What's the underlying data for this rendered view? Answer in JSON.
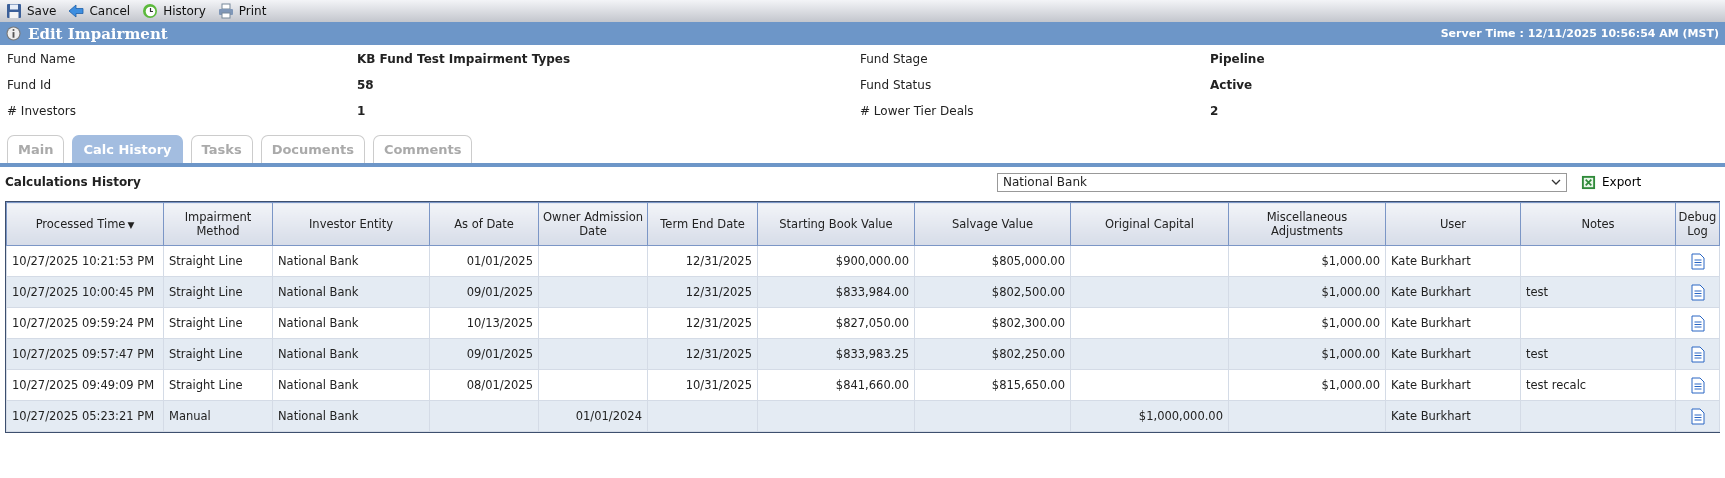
{
  "toolbar": [
    {
      "label": "Save"
    },
    {
      "label": "Cancel"
    },
    {
      "label": "History"
    },
    {
      "label": "Print"
    }
  ],
  "header": {
    "title": "Edit Impairment",
    "server_time": "Server Time : 12/11/2025 10:56:54 AM (MST)"
  },
  "fund_info": [
    {
      "label": "Fund Name",
      "value": "KB Fund Test Impairment Types"
    },
    {
      "label": "Fund Stage",
      "value": "Pipeline"
    },
    {
      "label": "Fund Id",
      "value": "58"
    },
    {
      "label": "Fund Status",
      "value": "Active"
    },
    {
      "label": "# Investors",
      "value": "1"
    },
    {
      "label": "# Lower Tier Deals",
      "value": "2"
    }
  ],
  "tabs": [
    {
      "label": "Main",
      "selected": false
    },
    {
      "label": "Calc History",
      "selected": true
    },
    {
      "label": "Tasks",
      "selected": false
    },
    {
      "label": "Documents",
      "selected": false
    },
    {
      "label": "Comments",
      "selected": false
    }
  ],
  "section": {
    "title": "Calculations History",
    "filter_value": "National Bank",
    "export_label": "Export"
  },
  "table": {
    "columns": [
      {
        "label": "Processed Time",
        "sort_arrow": "▼"
      },
      {
        "label": "Impairment Method"
      },
      {
        "label": "Investor Entity"
      },
      {
        "label": "As of Date"
      },
      {
        "label": "Owner Admission Date"
      },
      {
        "label": "Term End Date"
      },
      {
        "label": "Starting Book Value"
      },
      {
        "label": "Salvage Value"
      },
      {
        "label": "Original Capital"
      },
      {
        "label": "Miscellaneous Adjustments"
      },
      {
        "label": "User"
      },
      {
        "label": "Notes"
      },
      {
        "label": "Debug Log"
      }
    ],
    "rows": [
      [
        "10/27/2025 10:21:53 PM",
        "Straight Line",
        "National Bank",
        "01/01/2025",
        null,
        "12/31/2025",
        "$900,000.00",
        "$805,000.00",
        null,
        "$1,000.00",
        "Kate Burkhart",
        null
      ],
      [
        "10/27/2025 10:00:45 PM",
        "Straight Line",
        "National Bank",
        "09/01/2025",
        null,
        "12/31/2025",
        "$833,984.00",
        "$802,500.00",
        null,
        "$1,000.00",
        "Kate Burkhart",
        "test"
      ],
      [
        "10/27/2025 09:59:24 PM",
        "Straight Line",
        "National Bank",
        "10/13/2025",
        null,
        "12/31/2025",
        "$827,050.00",
        "$802,300.00",
        null,
        "$1,000.00",
        "Kate Burkhart",
        null
      ],
      [
        "10/27/2025 09:57:47 PM",
        "Straight Line",
        "National Bank",
        "09/01/2025",
        null,
        "12/31/2025",
        "$833,983.25",
        "$802,250.00",
        null,
        "$1,000.00",
        "Kate Burkhart",
        "test"
      ],
      [
        "10/27/2025 09:49:09 PM",
        "Straight Line",
        "National Bank",
        "08/01/2025",
        null,
        "10/31/2025",
        "$841,660.00",
        "$815,650.00",
        null,
        "$1,000.00",
        "Kate Burkhart",
        "test recalc"
      ],
      [
        "10/27/2025 05:23:21 PM",
        "Manual",
        "National Bank",
        null,
        "01/01/2024",
        null,
        null,
        null,
        "$1,000,000.00",
        null,
        "Kate Burkhart",
        null
      ]
    ]
  }
}
